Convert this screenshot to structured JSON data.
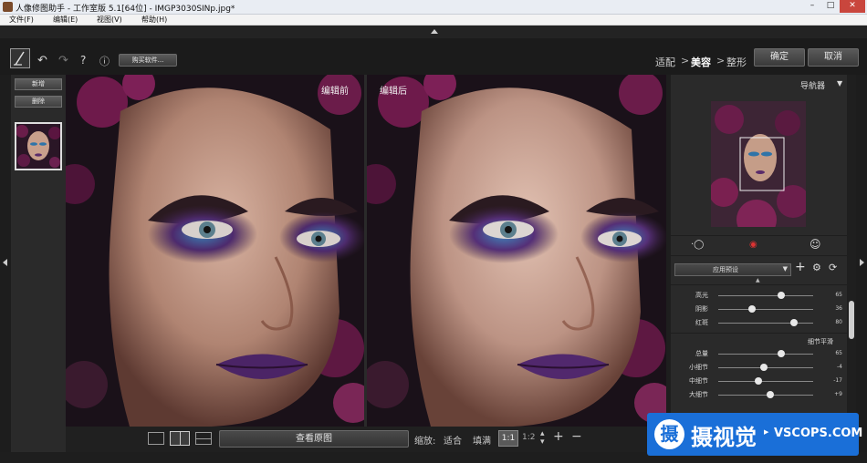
{
  "window": {
    "title": "人像修图助手 - 工作室版 5.1[64位] - IMGP3030SINp.jpg*",
    "controls": [
      "–",
      "□",
      "✕"
    ]
  },
  "menu": [
    "文件(F)",
    "编辑(E)",
    "视图(V)",
    "帮助(H)"
  ],
  "toolbar": {
    "help": "?",
    "info": "ⓘ",
    "buy_label": "购买软件...",
    "steps": {
      "fit": "适配",
      "sep1": ">",
      "beauty": "美容",
      "sep2": ">",
      "shape": "整形"
    },
    "confirm": "确定",
    "cancel": "取消"
  },
  "left": {
    "add": "新增",
    "delete": "删除"
  },
  "viewer": {
    "before": "编辑前",
    "after": "编辑后"
  },
  "bottom": {
    "view_original": "查看原图",
    "zoom_label": "缩放:",
    "fit": "适合",
    "fill": "填满",
    "one_to_one": "1:1",
    "one_to_two": "1:2",
    "plus": "+",
    "minus": "−"
  },
  "right": {
    "navigator": "导航器",
    "preset": "应用预设",
    "add": "+",
    "settings": "⚙",
    "reset": "⟳"
  },
  "sliders_a": [
    {
      "label": "高光",
      "value": "65",
      "frac": 0.66
    },
    {
      "label": "阴影",
      "value": "36",
      "frac": 0.36
    },
    {
      "label": "红斑",
      "value": "80",
      "frac": 0.8
    }
  ],
  "section_detail": "细节平滑",
  "sliders_b": [
    {
      "label": "总量",
      "value": "65",
      "frac": 0.66
    },
    {
      "label": "小细节",
      "value": "-4",
      "frac": 0.48
    },
    {
      "label": "中细节",
      "value": "-17",
      "frac": 0.42
    },
    {
      "label": "大细节",
      "value": "+9",
      "frac": 0.55
    }
  ],
  "watermark": {
    "glyph": "摄",
    "text": "摄视觉",
    "site": "VSCOPS.COM"
  },
  "colors": {
    "accent": "#1a6fd8",
    "bg": "#2a2a2a"
  }
}
